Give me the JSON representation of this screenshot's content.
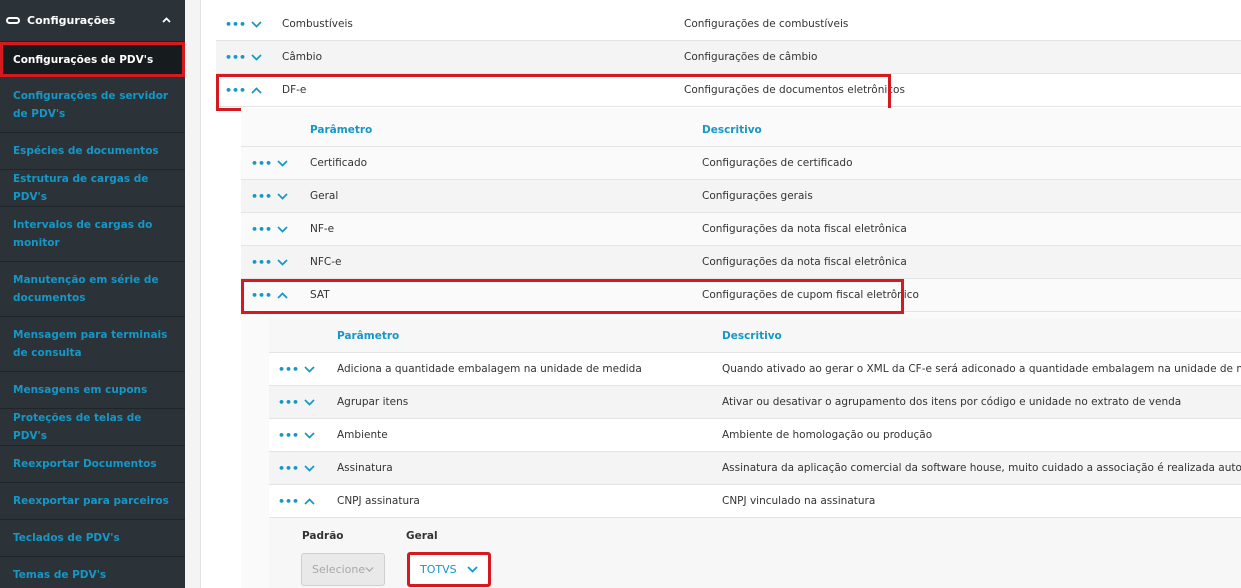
{
  "sidebar": {
    "section_title": "Configurações",
    "items": [
      {
        "label": "Configurações de PDV's",
        "active": true
      },
      {
        "label": "Configurações de servidor de PDV's"
      },
      {
        "label": "Espécies de documentos"
      },
      {
        "label": "Estrutura de cargas de PDV's"
      },
      {
        "label": "Intervalos de cargas do monitor"
      },
      {
        "label": "Manutenção em série de documentos"
      },
      {
        "label": "Mensagem para terminais de consulta"
      },
      {
        "label": "Mensagens em cupons"
      },
      {
        "label": "Proteções de telas de PDV's"
      },
      {
        "label": "Reexportar Documentos"
      },
      {
        "label": "Reexportar para parceiros"
      },
      {
        "label": "Teclados de PDV's"
      },
      {
        "label": "Temas de PDV's"
      }
    ]
  },
  "dots": "•••",
  "level1": [
    {
      "name": "Combustíveis",
      "desc": "Configurações de combustíveis"
    },
    {
      "name": "Câmbio",
      "desc": "Configurações de câmbio"
    },
    {
      "name": "DF-e",
      "desc": "Configurações de documentos eletrônicos"
    }
  ],
  "level2": {
    "header": {
      "param": "Parâmetro",
      "desc": "Descritivo"
    },
    "rows": [
      {
        "name": "Certificado",
        "desc": "Configurações de certificado"
      },
      {
        "name": "Geral",
        "desc": "Configurações gerais"
      },
      {
        "name": "NF-e",
        "desc": "Configurações da nota fiscal eletrônica"
      },
      {
        "name": "NFC-e",
        "desc": "Configurações da nota fiscal eletrônica"
      },
      {
        "name": "SAT",
        "desc": "Configurações de cupom fiscal eletrônico"
      }
    ]
  },
  "level3": {
    "header": {
      "param": "Parâmetro",
      "desc": "Descritivo"
    },
    "rows": [
      {
        "name": "Adiciona a quantidade embalagem na unidade de medida",
        "desc": "Quando ativado ao gerar o XML da CF-e será adiconado a quantidade embalagem na unidade de medida"
      },
      {
        "name": "Agrupar itens",
        "desc": "Ativar ou desativar o agrupamento dos itens por código e unidade no extrato de venda"
      },
      {
        "name": "Ambiente",
        "desc": "Ambiente de homologação ou produção"
      },
      {
        "name": "Assinatura",
        "desc": "Assinatura da aplicação comercial da software house, muito cuidado a associação é realizada automaticamente"
      },
      {
        "name": "CNPJ assinatura",
        "desc": "CNPJ vinculado na assinatura"
      }
    ]
  },
  "detail": {
    "padrao_label": "Padrão",
    "geral_label": "Geral",
    "padrao_value": "Selecione",
    "geral_value": "TOTVS"
  }
}
